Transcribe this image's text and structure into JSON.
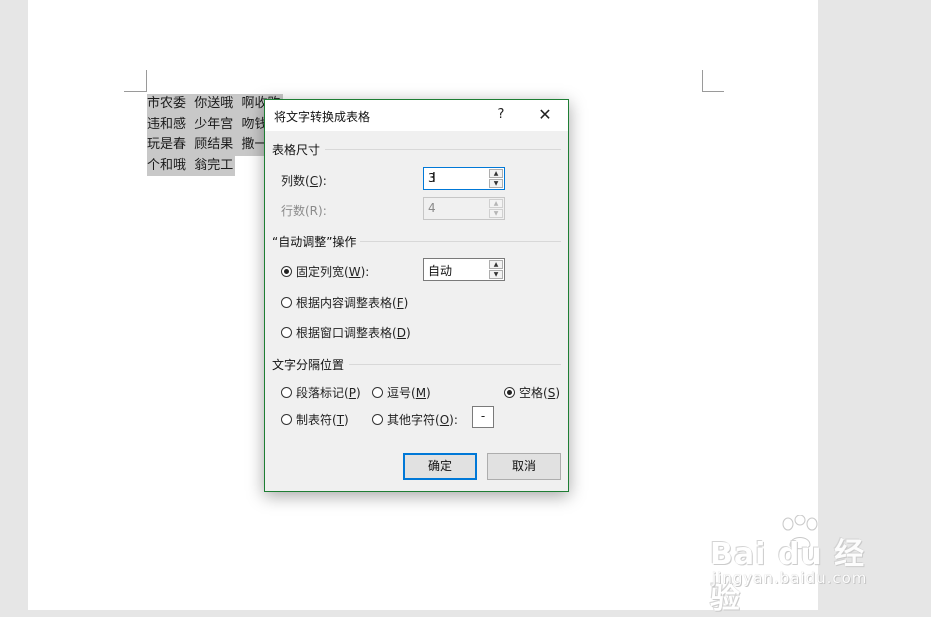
{
  "document": {
    "lines": [
      "市农委  你送哦  啊收购",
      "违和感  少年宫  吻钱",
      "玩是春  顾结果  撒一",
      "个和哦  翁完工"
    ]
  },
  "dialog": {
    "title": "将文字转换成表格",
    "help_label": "?",
    "close_label": "✕",
    "table_size": {
      "section_label": "表格尺寸",
      "columns": {
        "label_pre": "列数(",
        "accel": "C",
        "label_post": "):",
        "value": "3"
      },
      "rows": {
        "label": "行数(R):",
        "value": "4"
      }
    },
    "autofit": {
      "section_label": "“自动调整”操作",
      "fixed_width": {
        "label_pre": "固定列宽(",
        "accel": "W",
        "label_post": "):",
        "value": "自动",
        "checked": true
      },
      "fit_contents": {
        "label_pre": "根据内容调整表格(",
        "accel": "F",
        "label_post": ")",
        "checked": false
      },
      "fit_window": {
        "label_pre": "根据窗口调整表格(",
        "accel": "D",
        "label_post": ")",
        "checked": false
      }
    },
    "separator": {
      "section_label": "文字分隔位置",
      "paragraph": {
        "label_pre": "段落标记(",
        "accel": "P",
        "label_post": ")",
        "checked": false
      },
      "comma": {
        "label_pre": "逗号(",
        "accel": "M",
        "label_post": ")",
        "checked": false
      },
      "space": {
        "label_pre": "空格(",
        "accel": "S",
        "label_post": ")",
        "checked": true
      },
      "tab": {
        "label_pre": "制表符(",
        "accel": "T",
        "label_post": ")",
        "checked": false
      },
      "other": {
        "label_pre": "其他字符(",
        "accel": "O",
        "label_post": "):",
        "value": "-",
        "checked": false
      }
    },
    "ok_label": "确定",
    "cancel_label": "取消"
  },
  "watermark": {
    "brand": "Bai du 经验",
    "url": "jingyan.baidu.com"
  }
}
